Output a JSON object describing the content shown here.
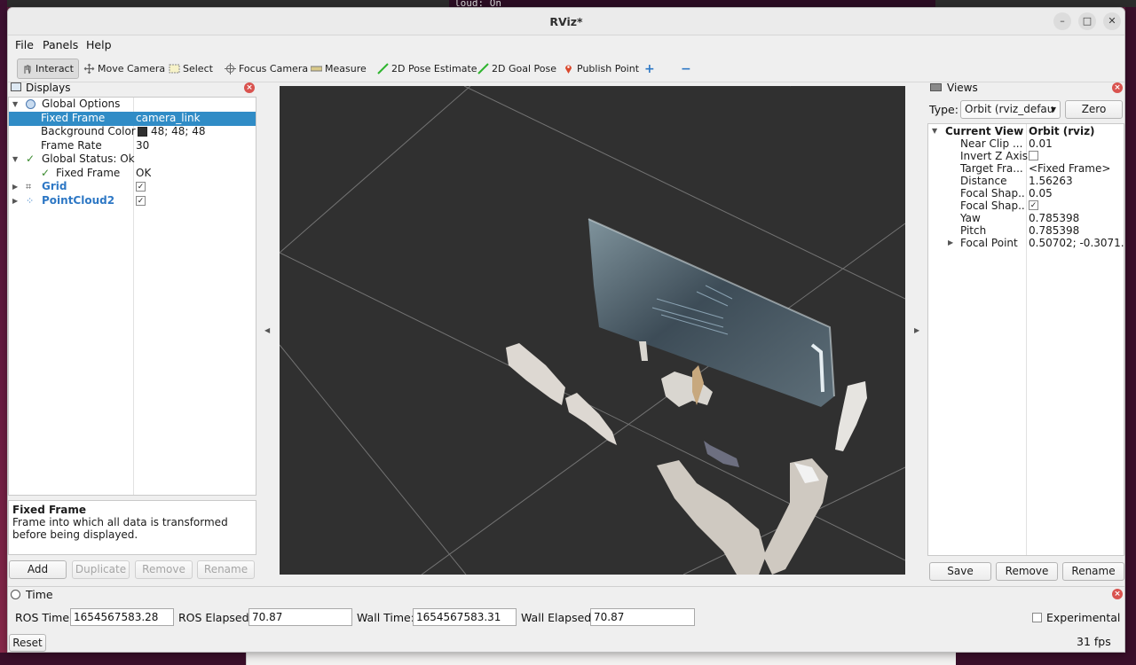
{
  "desktop": {
    "terminal_text": "loud: On"
  },
  "window": {
    "title": "RViz*",
    "controls": {
      "minimize": "–",
      "maximize": "□",
      "close": "✕"
    }
  },
  "menu": {
    "file": "File",
    "panels": "Panels",
    "help": "Help"
  },
  "toolbar": {
    "interact": "Interact",
    "move_camera": "Move Camera",
    "select": "Select",
    "focus_camera": "Focus Camera",
    "measure": "Measure",
    "pose_estimate": "2D Pose Estimate",
    "goal_pose": "2D Goal Pose",
    "publish_point": "Publish Point",
    "add_tool": "+",
    "remove_tool": "−"
  },
  "displays": {
    "title": "Displays",
    "rows": [
      {
        "label": "Global Options",
        "value": ""
      },
      {
        "label": "Fixed Frame",
        "value": "camera_link"
      },
      {
        "label": "Background Color",
        "value": "48; 48; 48"
      },
      {
        "label": "Frame Rate",
        "value": "30"
      },
      {
        "label": "Global Status: Ok",
        "value": ""
      },
      {
        "label": "Fixed Frame",
        "value": "OK"
      },
      {
        "label": "Grid",
        "value": ""
      },
      {
        "label": "PointCloud2",
        "value": ""
      }
    ],
    "background_color_hex": "#303030",
    "description_title": "Fixed Frame",
    "description_text": "Frame into which all data is transformed before being displayed.",
    "buttons": {
      "add": "Add",
      "duplicate": "Duplicate",
      "remove": "Remove",
      "rename": "Rename"
    }
  },
  "views": {
    "title": "Views",
    "type_label": "Type:",
    "type_value": "Orbit (rviz_defau",
    "zero": "Zero",
    "rows": [
      {
        "label": "Current View",
        "value": "Orbit (rviz)"
      },
      {
        "label": "Near Clip ...",
        "value": "0.01"
      },
      {
        "label": "Invert Z Axis",
        "value": ""
      },
      {
        "label": "Target Fra...",
        "value": "<Fixed Frame>"
      },
      {
        "label": "Distance",
        "value": "1.56263"
      },
      {
        "label": "Focal Shap...",
        "value": "0.05"
      },
      {
        "label": "Focal Shap...",
        "value": ""
      },
      {
        "label": "Yaw",
        "value": "0.785398"
      },
      {
        "label": "Pitch",
        "value": "0.785398"
      },
      {
        "label": "Focal Point",
        "value": "0.50702; -0.3071..."
      }
    ],
    "buttons": {
      "save": "Save",
      "remove": "Remove",
      "rename": "Rename"
    }
  },
  "time": {
    "title": "Time",
    "ros_time_label": "ROS Time:",
    "ros_time": "1654567583.28",
    "ros_elapsed_label": "ROS Elapsed:",
    "ros_elapsed": "70.87",
    "wall_time_label": "Wall Time:",
    "wall_time": "1654567583.31",
    "wall_elapsed_label": "Wall Elapsed:",
    "wall_elapsed": "70.87",
    "experimental": "Experimental",
    "fps": "31 fps",
    "reset": "Reset"
  }
}
